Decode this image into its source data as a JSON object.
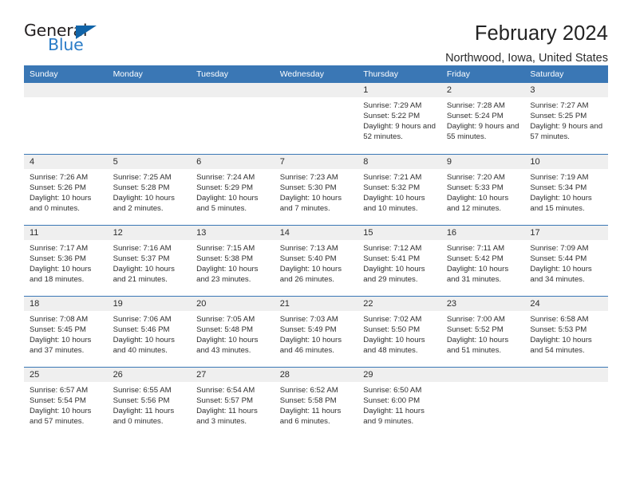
{
  "logo": {
    "word_top": "General",
    "word_bottom": "Blue",
    "accent_color": "#1164a8",
    "text_color": "#231f20",
    "blue_text_color": "#2a7cc7"
  },
  "header": {
    "title": "February 2024",
    "subtitle": "Northwood, Iowa, United States"
  },
  "theme": {
    "header_bar": "#3a77b5",
    "daynum_bg": "#efefef",
    "row_rule": "#3a77b5"
  },
  "weekday_headers": [
    "Sunday",
    "Monday",
    "Tuesday",
    "Wednesday",
    "Thursday",
    "Friday",
    "Saturday"
  ],
  "weeks": [
    [
      {
        "day": "",
        "sunrise": "",
        "sunset": "",
        "daylight": "",
        "empty": true
      },
      {
        "day": "",
        "sunrise": "",
        "sunset": "",
        "daylight": "",
        "empty": true
      },
      {
        "day": "",
        "sunrise": "",
        "sunset": "",
        "daylight": "",
        "empty": true
      },
      {
        "day": "",
        "sunrise": "",
        "sunset": "",
        "daylight": "",
        "empty": true
      },
      {
        "day": "1",
        "sunrise": "Sunrise: 7:29 AM",
        "sunset": "Sunset: 5:22 PM",
        "daylight": "Daylight: 9 hours and 52 minutes."
      },
      {
        "day": "2",
        "sunrise": "Sunrise: 7:28 AM",
        "sunset": "Sunset: 5:24 PM",
        "daylight": "Daylight: 9 hours and 55 minutes."
      },
      {
        "day": "3",
        "sunrise": "Sunrise: 7:27 AM",
        "sunset": "Sunset: 5:25 PM",
        "daylight": "Daylight: 9 hours and 57 minutes."
      }
    ],
    [
      {
        "day": "4",
        "sunrise": "Sunrise: 7:26 AM",
        "sunset": "Sunset: 5:26 PM",
        "daylight": "Daylight: 10 hours and 0 minutes."
      },
      {
        "day": "5",
        "sunrise": "Sunrise: 7:25 AM",
        "sunset": "Sunset: 5:28 PM",
        "daylight": "Daylight: 10 hours and 2 minutes."
      },
      {
        "day": "6",
        "sunrise": "Sunrise: 7:24 AM",
        "sunset": "Sunset: 5:29 PM",
        "daylight": "Daylight: 10 hours and 5 minutes."
      },
      {
        "day": "7",
        "sunrise": "Sunrise: 7:23 AM",
        "sunset": "Sunset: 5:30 PM",
        "daylight": "Daylight: 10 hours and 7 minutes."
      },
      {
        "day": "8",
        "sunrise": "Sunrise: 7:21 AM",
        "sunset": "Sunset: 5:32 PM",
        "daylight": "Daylight: 10 hours and 10 minutes."
      },
      {
        "day": "9",
        "sunrise": "Sunrise: 7:20 AM",
        "sunset": "Sunset: 5:33 PM",
        "daylight": "Daylight: 10 hours and 12 minutes."
      },
      {
        "day": "10",
        "sunrise": "Sunrise: 7:19 AM",
        "sunset": "Sunset: 5:34 PM",
        "daylight": "Daylight: 10 hours and 15 minutes."
      }
    ],
    [
      {
        "day": "11",
        "sunrise": "Sunrise: 7:17 AM",
        "sunset": "Sunset: 5:36 PM",
        "daylight": "Daylight: 10 hours and 18 minutes."
      },
      {
        "day": "12",
        "sunrise": "Sunrise: 7:16 AM",
        "sunset": "Sunset: 5:37 PM",
        "daylight": "Daylight: 10 hours and 21 minutes."
      },
      {
        "day": "13",
        "sunrise": "Sunrise: 7:15 AM",
        "sunset": "Sunset: 5:38 PM",
        "daylight": "Daylight: 10 hours and 23 minutes."
      },
      {
        "day": "14",
        "sunrise": "Sunrise: 7:13 AM",
        "sunset": "Sunset: 5:40 PM",
        "daylight": "Daylight: 10 hours and 26 minutes."
      },
      {
        "day": "15",
        "sunrise": "Sunrise: 7:12 AM",
        "sunset": "Sunset: 5:41 PM",
        "daylight": "Daylight: 10 hours and 29 minutes."
      },
      {
        "day": "16",
        "sunrise": "Sunrise: 7:11 AM",
        "sunset": "Sunset: 5:42 PM",
        "daylight": "Daylight: 10 hours and 31 minutes."
      },
      {
        "day": "17",
        "sunrise": "Sunrise: 7:09 AM",
        "sunset": "Sunset: 5:44 PM",
        "daylight": "Daylight: 10 hours and 34 minutes."
      }
    ],
    [
      {
        "day": "18",
        "sunrise": "Sunrise: 7:08 AM",
        "sunset": "Sunset: 5:45 PM",
        "daylight": "Daylight: 10 hours and 37 minutes."
      },
      {
        "day": "19",
        "sunrise": "Sunrise: 7:06 AM",
        "sunset": "Sunset: 5:46 PM",
        "daylight": "Daylight: 10 hours and 40 minutes."
      },
      {
        "day": "20",
        "sunrise": "Sunrise: 7:05 AM",
        "sunset": "Sunset: 5:48 PM",
        "daylight": "Daylight: 10 hours and 43 minutes."
      },
      {
        "day": "21",
        "sunrise": "Sunrise: 7:03 AM",
        "sunset": "Sunset: 5:49 PM",
        "daylight": "Daylight: 10 hours and 46 minutes."
      },
      {
        "day": "22",
        "sunrise": "Sunrise: 7:02 AM",
        "sunset": "Sunset: 5:50 PM",
        "daylight": "Daylight: 10 hours and 48 minutes."
      },
      {
        "day": "23",
        "sunrise": "Sunrise: 7:00 AM",
        "sunset": "Sunset: 5:52 PM",
        "daylight": "Daylight: 10 hours and 51 minutes."
      },
      {
        "day": "24",
        "sunrise": "Sunrise: 6:58 AM",
        "sunset": "Sunset: 5:53 PM",
        "daylight": "Daylight: 10 hours and 54 minutes."
      }
    ],
    [
      {
        "day": "25",
        "sunrise": "Sunrise: 6:57 AM",
        "sunset": "Sunset: 5:54 PM",
        "daylight": "Daylight: 10 hours and 57 minutes."
      },
      {
        "day": "26",
        "sunrise": "Sunrise: 6:55 AM",
        "sunset": "Sunset: 5:56 PM",
        "daylight": "Daylight: 11 hours and 0 minutes."
      },
      {
        "day": "27",
        "sunrise": "Sunrise: 6:54 AM",
        "sunset": "Sunset: 5:57 PM",
        "daylight": "Daylight: 11 hours and 3 minutes."
      },
      {
        "day": "28",
        "sunrise": "Sunrise: 6:52 AM",
        "sunset": "Sunset: 5:58 PM",
        "daylight": "Daylight: 11 hours and 6 minutes."
      },
      {
        "day": "29",
        "sunrise": "Sunrise: 6:50 AM",
        "sunset": "Sunset: 6:00 PM",
        "daylight": "Daylight: 11 hours and 9 minutes."
      },
      {
        "day": "",
        "sunrise": "",
        "sunset": "",
        "daylight": "",
        "empty": true
      },
      {
        "day": "",
        "sunrise": "",
        "sunset": "",
        "daylight": "",
        "empty": true
      }
    ]
  ]
}
